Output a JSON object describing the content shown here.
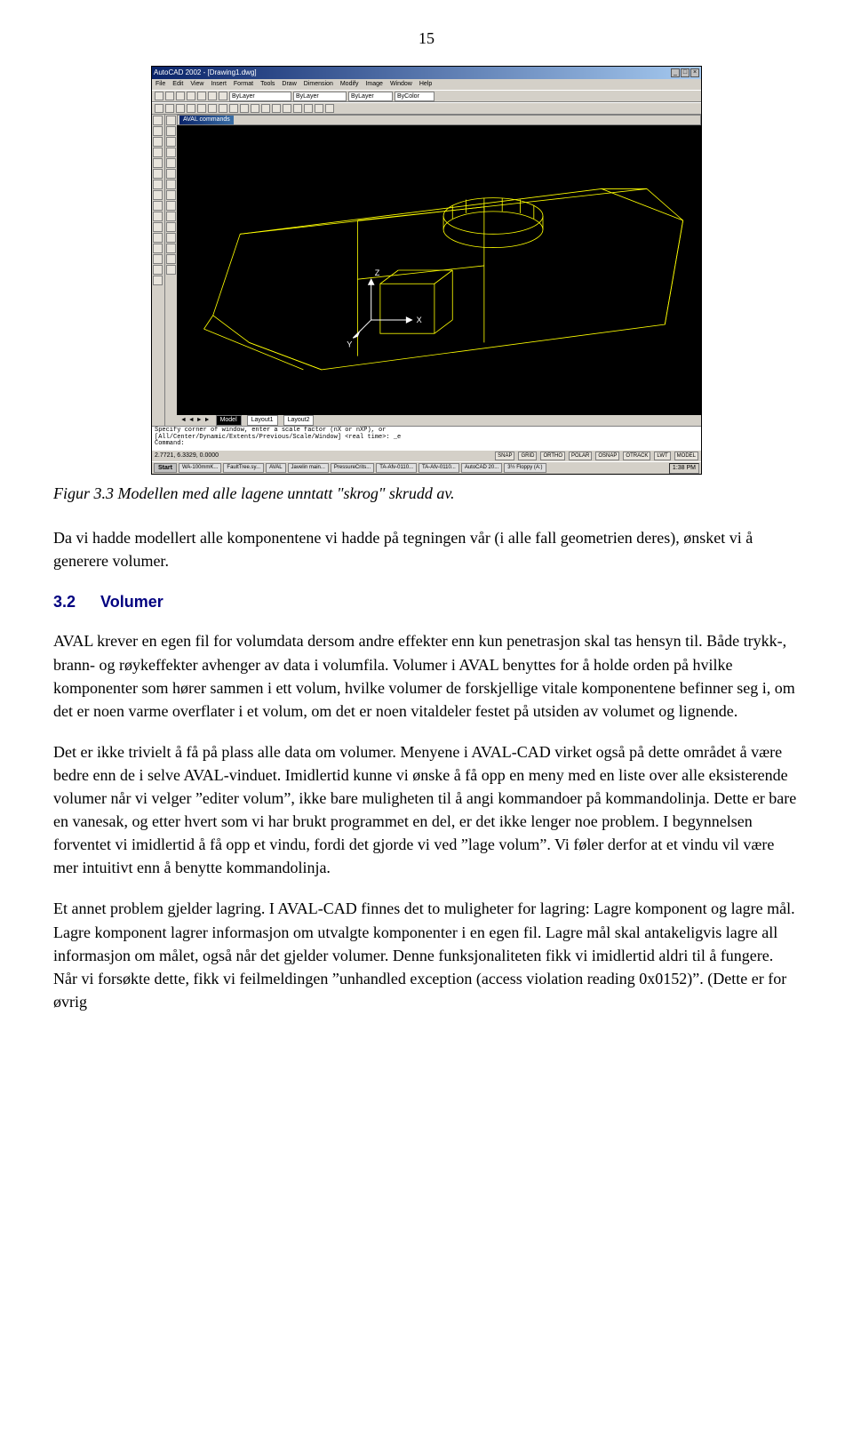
{
  "page_number": "15",
  "screenshot": {
    "app_title": "AutoCAD 2002 - [Drawing1.dwg]",
    "menus": [
      "File",
      "Edit",
      "View",
      "Insert",
      "Format",
      "Tools",
      "Draw",
      "Dimension",
      "Modify",
      "Image",
      "Window",
      "Help"
    ],
    "layer_selects": [
      "ByLayer",
      "ByLayer",
      "ByLayer",
      "ByColor"
    ],
    "aval_window_title": "AVAL commands",
    "ucs_labels": {
      "x": "X",
      "y": "Y",
      "z": "Z"
    },
    "tabs": {
      "nav": "◄ ◄ ► ►",
      "model": "Model",
      "layout1": "Layout1",
      "layout2": "Layout2"
    },
    "command_lines": [
      "Specify corner of window, enter a scale factor (nX or nXP), or",
      "[All/Center/Dynamic/Extents/Previous/Scale/Window] <real time>: _e",
      "Command:"
    ],
    "status_coords": "2.7721, 6.3329, 0.0000",
    "status_toggles": [
      "SNAP",
      "GRID",
      "ORTHO",
      "POLAR",
      "OSNAP",
      "OTRACK",
      "LWT",
      "MODEL"
    ],
    "taskbar": {
      "start": "Start",
      "items": [
        "WA-100mmK...",
        "FaultTree.sy...",
        "AVAL",
        "Javelin main...",
        "PressureCrits...",
        "TA-Afv-0110...",
        "TA-Afv-0110...",
        "AutoCAD 20...",
        "3½ Floppy (A:)"
      ],
      "clock": "1:38 PM"
    }
  },
  "caption": "Figur 3.3 Modellen med alle lagene unntatt \"skrog\" skrudd av.",
  "para1": "Da vi hadde modellert alle komponentene vi hadde på tegningen vår (i alle fall geometrien deres), ønsket vi å generere volumer.",
  "section": {
    "num": "3.2",
    "title": "Volumer"
  },
  "para2": "AVAL krever en egen fil for volumdata dersom andre effekter enn kun penetrasjon skal tas hensyn til. Både trykk-, brann- og røykeffekter avhenger av data i volumfila. Volumer i AVAL benyttes for å holde orden på hvilke komponenter som hører sammen i ett volum, hvilke volumer de forskjellige vitale komponentene befinner seg i, om det er noen varme overflater i et volum, om det er noen vitaldeler festet på utsiden av volumet og lignende.",
  "para3": "Det er ikke trivielt å få på plass alle data om volumer. Menyene i AVAL-CAD virket også på dette området å være bedre enn de i selve AVAL-vinduet. Imidlertid kunne vi ønske å få opp en meny med en liste over alle eksisterende volumer når vi velger ”editer volum”, ikke bare muligheten til å angi kommandoer på kommandolinja. Dette er bare en vanesak, og etter hvert som vi har brukt programmet en del, er det ikke lenger noe problem. I begynnelsen forventet vi imidlertid å få opp et vindu, fordi det gjorde vi ved ”lage volum”. Vi føler derfor at et vindu vil være mer intuitivt enn å benytte kommandolinja.",
  "para4": "Et annet problem gjelder lagring. I AVAL-CAD finnes det to muligheter for lagring: Lagre komponent og lagre mål. Lagre komponent lagrer informasjon om utvalgte komponenter i en egen fil. Lagre mål skal antakeligvis lagre all informasjon om målet, også når det gjelder volumer. Denne funksjonaliteten fikk vi imidlertid aldri til å fungere. Når vi forsøkte dette, fikk vi feilmeldingen ”unhandled exception (access violation reading 0x0152)”. (Dette er for øvrig"
}
